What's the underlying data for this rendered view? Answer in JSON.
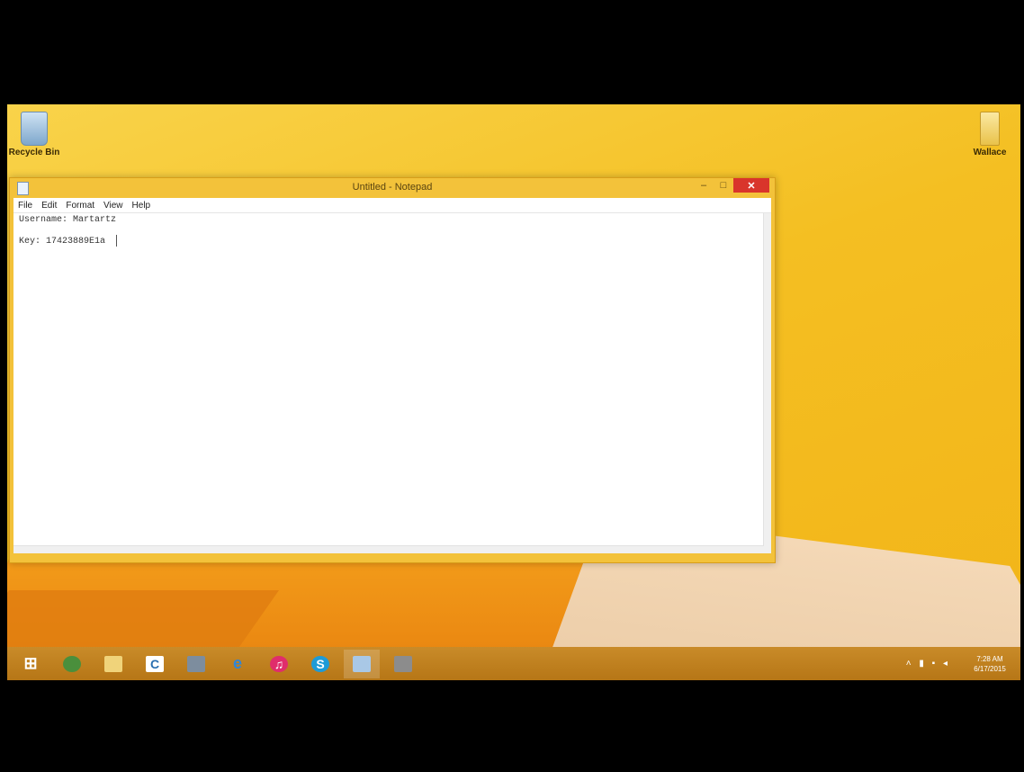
{
  "desktop": {
    "icons": [
      {
        "label": "Recycle Bin",
        "icon": "recycle-bin-icon"
      },
      {
        "label": "Wallace",
        "icon": "folder-icon"
      }
    ]
  },
  "notepad": {
    "title": "Untitled - Notepad",
    "controls": {
      "minimize": "–",
      "maximize": "□",
      "close": "✕"
    },
    "menu": [
      "File",
      "Edit",
      "Format",
      "View",
      "Help"
    ],
    "lines": [
      "Username: Martartz",
      "",
      "Key: 17423889E1a"
    ]
  },
  "taskbar": {
    "icons": [
      {
        "name": "start-windows-icon",
        "color": "#ffffff"
      },
      {
        "name": "chrome-icon",
        "color": "#4a8f3c"
      },
      {
        "name": "file-explorer-icon",
        "color": "#f0d37a"
      },
      {
        "name": "ccleaner-icon",
        "color": "#ffffff"
      },
      {
        "name": "computer-icon",
        "color": "#7d8d9e"
      },
      {
        "name": "internet-explorer-icon",
        "color": "#2f86d8"
      },
      {
        "name": "itunes-icon",
        "color": "#e02d6b"
      },
      {
        "name": "skype-icon",
        "color": "#1e9bd7"
      },
      {
        "name": "notepad-icon",
        "color": "#a9c8e6"
      },
      {
        "name": "recorder-icon",
        "color": "#8c8c8c"
      }
    ],
    "tray": {
      "icons": [
        "chevron-up-icon",
        "flag-icon",
        "network-icon",
        "volume-icon"
      ],
      "time": "7:28 AM",
      "date": "6/17/2015"
    }
  }
}
